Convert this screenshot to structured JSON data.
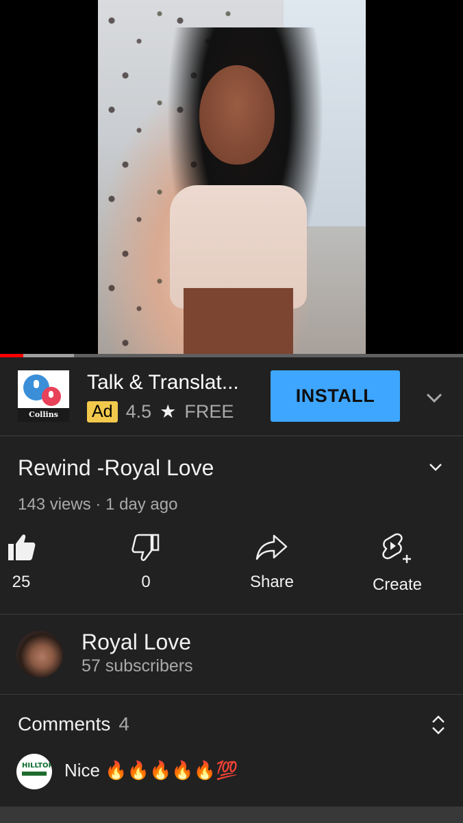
{
  "video": {
    "progress_played_fraction": 0.05,
    "progress_buffered_fraction": 0.16
  },
  "ad": {
    "brand": "Collins",
    "title": "Talk & Translat...",
    "badge": "Ad",
    "rating": "4.5",
    "rating_icon": "star-icon",
    "price": "FREE",
    "install_label": "INSTALL",
    "accent": "#3ea6ff"
  },
  "video_info": {
    "title": "Rewind -Royal Love",
    "stats": "143 views · 1 day ago"
  },
  "actions": {
    "like_count": "25",
    "dislike_count": "0",
    "share_label": "Share",
    "create_label": "Create"
  },
  "channel": {
    "name": "Royal Love",
    "subscribers": "57 subscribers"
  },
  "comments": {
    "label": "Comments",
    "count": "4",
    "top_comment": {
      "avatar_logo_text": "HILLTOP",
      "text": "Nice 🔥🔥🔥🔥🔥💯"
    }
  }
}
